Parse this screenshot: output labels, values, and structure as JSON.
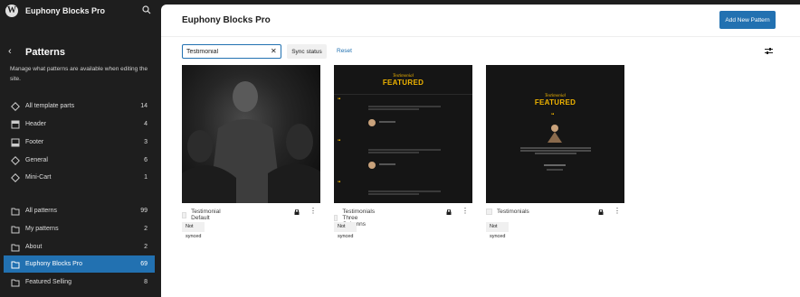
{
  "site": {
    "title": "Euphony Blocks Pro"
  },
  "sidebar": {
    "title": "Patterns",
    "description": "Manage what patterns are available when editing the site.",
    "template_parts": [
      {
        "label": "All template parts",
        "count": "14",
        "icon": "diamond-icon"
      },
      {
        "label": "Header",
        "count": "4",
        "icon": "header-icon"
      },
      {
        "label": "Footer",
        "count": "3",
        "icon": "footer-icon"
      },
      {
        "label": "General",
        "count": "6",
        "icon": "diamond-icon"
      },
      {
        "label": "Mini-Cart",
        "count": "1",
        "icon": "diamond-icon"
      }
    ],
    "patterns": [
      {
        "label": "All patterns",
        "count": "99"
      },
      {
        "label": "My patterns",
        "count": "2"
      },
      {
        "label": "About",
        "count": "2"
      },
      {
        "label": "Euphony Blocks Pro",
        "count": "69",
        "active": true
      },
      {
        "label": "Featured Selling",
        "count": "8"
      }
    ]
  },
  "main": {
    "title": "Euphony Blocks Pro",
    "add_button": "Add New Pattern",
    "search": {
      "value": "Testimonial",
      "placeholder": "Search"
    },
    "sync_label": "Sync status",
    "reset_label": "Reset",
    "cards": [
      {
        "name": "Testimonial Default",
        "badge": "Not synced"
      },
      {
        "name": "Testimonials Three Columns",
        "badge": "Not synced"
      },
      {
        "name": "Testimonials",
        "badge": "Not synced"
      }
    ],
    "preview": {
      "subtitle": "Testimonial",
      "title": "FEATURED"
    }
  },
  "colors": {
    "accent": "#2271b1",
    "sidebar_bg": "#1e1e1e",
    "gold": "#f0b400"
  }
}
